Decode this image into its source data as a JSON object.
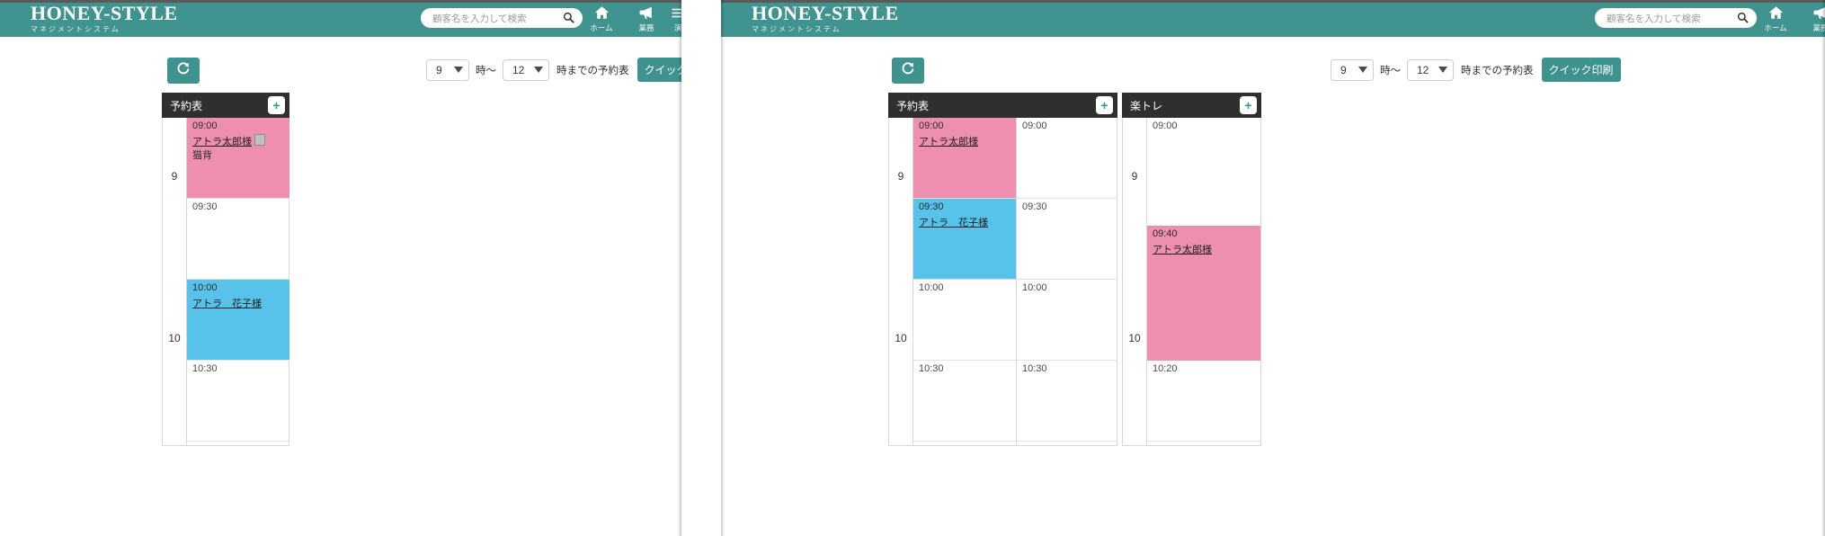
{
  "app": {
    "brand_main": "HONEY-STYLE",
    "brand_sub": "マネジメントシステム",
    "brand_color": "#409490",
    "accent_color": "#3f938f"
  },
  "search": {
    "placeholder": "顧客名を入力して検索",
    "value": "",
    "icon": "search-icon"
  },
  "nav": [
    {
      "label": "ホーム",
      "icon": "home-icon"
    },
    {
      "label": "業務",
      "icon": "megaphone-icon"
    },
    {
      "label": "演",
      "icon": "menu-icon"
    }
  ],
  "toolbar": {
    "reload_icon": "refresh-icon",
    "start_hour": "9",
    "end_hour": "12",
    "between_label": "時〜",
    "suffix_label": "時までの予約表",
    "print_label": "クイック印刷"
  },
  "schedule": {
    "add_icon": "plus-icon",
    "columns_left": [
      {
        "title": "予約表"
      }
    ],
    "columns_right": [
      {
        "title": "予約表"
      },
      {
        "title": "楽トレ"
      }
    ],
    "hours": [
      "9",
      "10"
    ],
    "left_slot_times": [
      "09:00",
      "09:30",
      "10:00",
      "10:30"
    ],
    "right_col1_times": [
      "09:00",
      "09:30",
      "10:00",
      "10:30"
    ],
    "right_col2_times": [
      "09:00",
      "09:40",
      "10:20"
    ]
  },
  "appointments": {
    "left": [
      {
        "time": "09:00",
        "customer": "アトラ太郎様",
        "memo": "猫背",
        "color": "pink",
        "has_memo_icon": true
      },
      {
        "time": "10:00",
        "customer": "アトラ　花子様",
        "memo": "",
        "color": "blue",
        "has_memo_icon": false
      }
    ],
    "right_col1": [
      {
        "time": "09:00",
        "customer": "アトラ太郎様",
        "memo": "",
        "color": "pink",
        "has_memo_icon": false
      },
      {
        "time": "09:30",
        "customer": "アトラ　花子様",
        "memo": "",
        "color": "blue",
        "has_memo_icon": false
      }
    ],
    "right_col2": [
      {
        "time": "09:40",
        "customer": "アトラ太郎様",
        "memo": "",
        "color": "pink",
        "has_memo_icon": false
      }
    ]
  },
  "colors": {
    "pink": "#ef8fb0",
    "blue": "#57c3ea",
    "header_dark": "#2f2f2f"
  }
}
